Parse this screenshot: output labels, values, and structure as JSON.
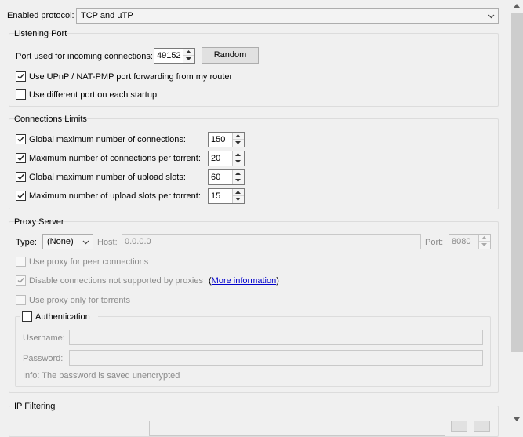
{
  "protocol": {
    "label": "Enabled protocol:",
    "value": "TCP and µTP"
  },
  "listening": {
    "title": "Listening Port",
    "port_label": "Port used for incoming connections:",
    "port_value": "49152",
    "random_label": "Random",
    "upnp_label": "Use UPnP / NAT-PMP port forwarding from my router",
    "upnp_checked": true,
    "diffport_label": "Use different port on each startup",
    "diffport_checked": false
  },
  "limits": {
    "title": "Connections Limits",
    "rows": [
      {
        "label": "Global maximum number of connections:",
        "value": "150",
        "checked": true
      },
      {
        "label": "Maximum number of connections per torrent:",
        "value": "20",
        "checked": true
      },
      {
        "label": "Global maximum number of upload slots:",
        "value": "60",
        "checked": true
      },
      {
        "label": "Maximum number of upload slots per torrent:",
        "value": "15",
        "checked": true
      }
    ]
  },
  "proxy": {
    "title": "Proxy Server",
    "type_label": "Type:",
    "type_value": "(None)",
    "host_label": "Host:",
    "host_value": "0.0.0.0",
    "port_label": "Port:",
    "port_value": "8080",
    "peer_label": "Use proxy for peer connections",
    "disable_label": "Disable connections not supported by proxies",
    "more_open": "(",
    "more_link": "More information",
    "more_close": ")",
    "only_label": "Use proxy only for torrents",
    "auth": {
      "title": "Authentication",
      "username_label": "Username:",
      "password_label": "Password:",
      "info": "Info: The password is saved unencrypted"
    }
  },
  "ipfilter": {
    "title": "IP Filtering"
  },
  "icons": {
    "check": "check-icon",
    "dropdown": "chevron-down-icon",
    "spin_up": "caret-up-icon",
    "spin_down": "caret-down-icon"
  }
}
